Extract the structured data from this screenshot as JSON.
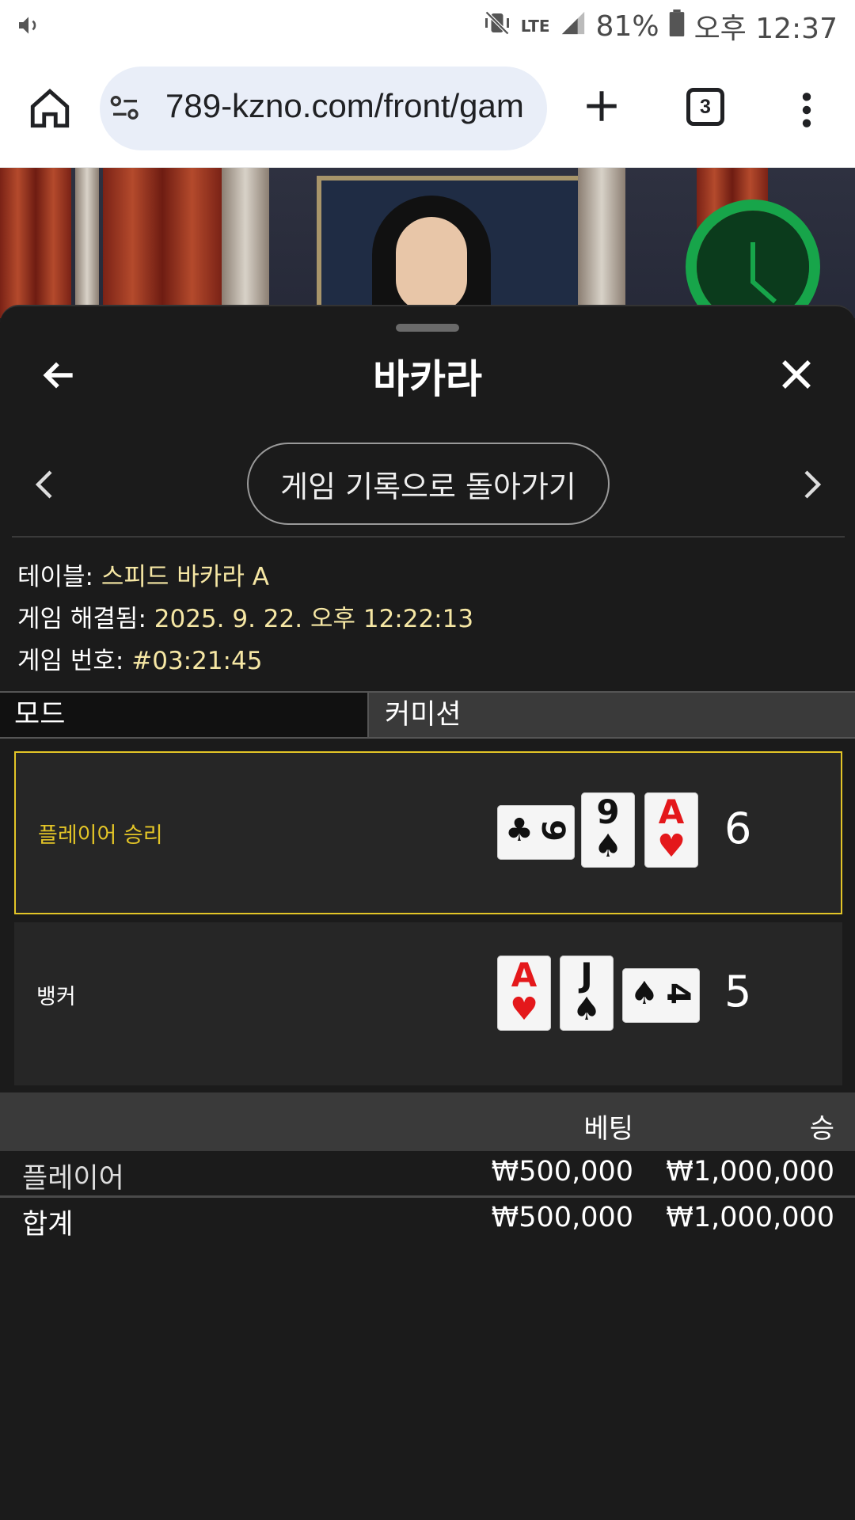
{
  "status_bar": {
    "battery": "81%",
    "network": "LTE",
    "time": "오후 12:37"
  },
  "browser": {
    "url": "789-kzno.com/front/gam",
    "tab_count": "3"
  },
  "sheet": {
    "title": "바카라",
    "history_button": "게임 기록으로 돌아가기",
    "info": {
      "table_label": "테이블:",
      "table_value": "스피드 바카라 A",
      "resolved_label": "게임 해결됨:",
      "resolved_value": "2025. 9. 22. 오후 12:22:13",
      "number_label": "게임 번호:",
      "number_value": "#03:21:45"
    },
    "mode": {
      "label": "모드",
      "value": "커미션"
    },
    "results": [
      {
        "label": "플레이어 승리",
        "winner": true,
        "score": "6",
        "cards": [
          {
            "rank": "9",
            "suit": "♣",
            "color": "#111111",
            "orientation": "horizontal"
          },
          {
            "rank": "9",
            "suit": "♠",
            "color": "#111111",
            "orientation": "vertical"
          },
          {
            "rank": "A",
            "suit": "♥",
            "color": "#e4181b",
            "orientation": "vertical"
          }
        ]
      },
      {
        "label": "뱅커",
        "winner": false,
        "score": "5",
        "cards": [
          {
            "rank": "A",
            "suit": "♥",
            "color": "#e4181b",
            "orientation": "vertical"
          },
          {
            "rank": "J",
            "suit": "♠",
            "color": "#111111",
            "orientation": "vertical"
          },
          {
            "rank": "4",
            "suit": "♠",
            "color": "#111111",
            "orientation": "horizontal"
          }
        ]
      }
    ],
    "bets": {
      "headers": {
        "bet": "베팅",
        "win": "승"
      },
      "rows": [
        {
          "name": "플레이어",
          "bet": "₩500,000",
          "win": "₩1,000,000"
        },
        {
          "name": "합계",
          "bet": "₩500,000",
          "win": "₩1,000,000"
        }
      ]
    }
  },
  "colors": {
    "accent_gold": "#e3c527",
    "info_value": "#f6e7a4",
    "timer_green": "#17a54a"
  }
}
